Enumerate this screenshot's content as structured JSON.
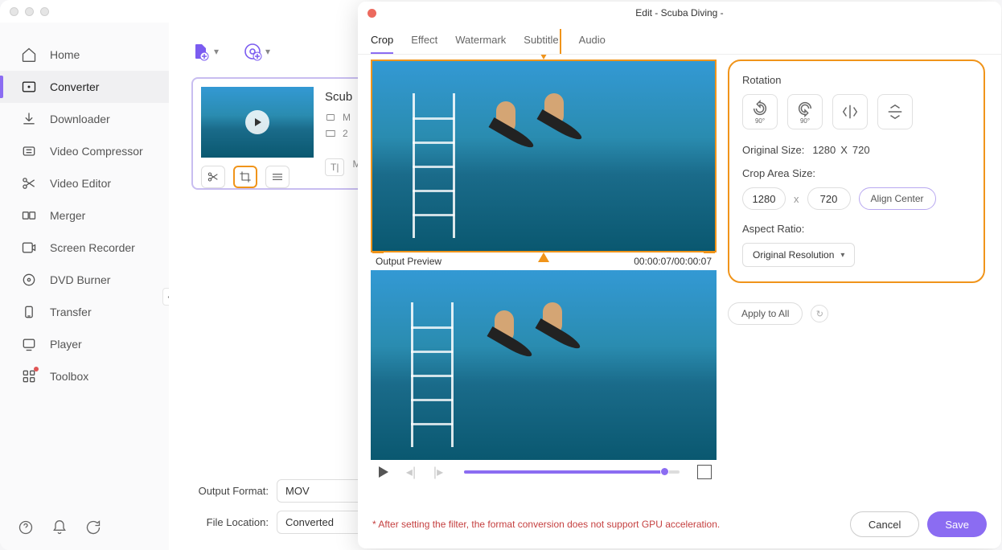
{
  "sidebar": {
    "items": [
      {
        "label": "Home"
      },
      {
        "label": "Converter"
      },
      {
        "label": "Downloader"
      },
      {
        "label": "Video Compressor"
      },
      {
        "label": "Video Editor"
      },
      {
        "label": "Merger"
      },
      {
        "label": "Screen Recorder"
      },
      {
        "label": "DVD Burner"
      },
      {
        "label": "Transfer"
      },
      {
        "label": "Player"
      },
      {
        "label": "Toolbox"
      }
    ]
  },
  "file": {
    "title": "Scub",
    "meta1": "M",
    "meta2": "2",
    "subtool": "M"
  },
  "bottom": {
    "output_format_label": "Output Format:",
    "output_format_value": "MOV",
    "file_location_label": "File Location:",
    "file_location_value": "Converted"
  },
  "modal": {
    "title": "Edit - Scuba Diving -",
    "tabs": [
      "Crop",
      "Effect",
      "Watermark",
      "Subtitle",
      "Audio"
    ],
    "preview_label": "Output Preview",
    "time": "00:00:07/00:00:07",
    "rotation_label": "Rotation",
    "rotate_left": "90°",
    "rotate_right": "90°",
    "orig_size_label": "Original Size:",
    "orig_w": "1280",
    "orig_x": "X",
    "orig_h": "720",
    "crop_label": "Crop Area Size:",
    "crop_w": "1280",
    "crop_h": "720",
    "align_center": "Align Center",
    "aspect_label": "Aspect Ratio:",
    "aspect_value": "Original Resolution",
    "apply_all": "Apply to All",
    "warning": "* After setting the filter, the format conversion does not support GPU acceleration.",
    "cancel": "Cancel",
    "save": "Save"
  }
}
